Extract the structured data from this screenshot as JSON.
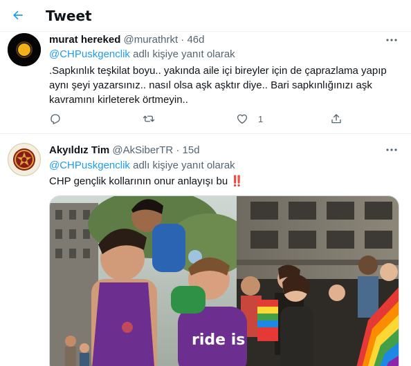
{
  "header": {
    "title": "Tweet",
    "back_icon": "arrow-left-icon",
    "accent_color": "#1d9bf0"
  },
  "tweets": [
    {
      "name": "murat hereked",
      "handle": "@murathrkt",
      "separator": "·",
      "time": "46d",
      "avatar_icon": "sun-avatar",
      "reply_mention": "@CHPuskgenclik",
      "reply_suffix": " adlı kişiye yanıt olarak",
      "text_lines": [
        ".Sapkınlık teşkilat boyu.. yakında aile içi bireyler için de çaprazlama yapıp",
        "aynı şeyi yazarsınız.. nasıl olsa aşk aşktır diye.. Bari sapkınlığınızı aşk",
        "kavramını kirleterek örtmeyin.."
      ],
      "actions": {
        "reply_icon": "reply-icon",
        "retweet_icon": "retweet-icon",
        "like_icon": "heart-icon",
        "like_count": "1",
        "share_icon": "share-icon"
      }
    },
    {
      "name": "Akyıldız Tim",
      "handle": "@AkSiberTR",
      "separator": "·",
      "time": "15d",
      "avatar_icon": "emblem-avatar",
      "reply_mention": "@CHPuskgenclik",
      "reply_suffix": " adlı kişiye yanıt olarak",
      "text": "CHP gençlik kollarının onur anlayışı bu ",
      "emoji": "‼️",
      "media": {
        "type": "photo",
        "shirt_text": "ride is"
      }
    }
  ]
}
